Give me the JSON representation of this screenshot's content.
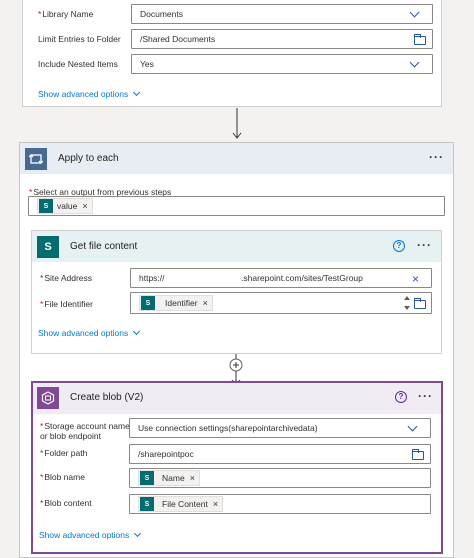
{
  "top_card": {
    "library_name": {
      "label": "Library Name",
      "required": true,
      "value": "Documents"
    },
    "limit_folder": {
      "label": "Limit Entries to Folder",
      "required": false,
      "value": "/Shared Documents"
    },
    "nested": {
      "label": "Include Nested Items",
      "required": false,
      "value": "Yes"
    },
    "advanced": "Show advanced options"
  },
  "apply_each": {
    "title": "Apply to each",
    "select_label": "Select an output from previous steps",
    "token": "value",
    "menu": "···"
  },
  "get_file": {
    "title": "Get file content",
    "site_label": "Site Address",
    "site_value_prefix": "https://",
    "site_value_suffix": ".sharepoint.com/sites/TestGroup",
    "file_label": "File Identifier",
    "file_token": "Identifier",
    "advanced": "Show advanced options",
    "help": "?",
    "menu": "···"
  },
  "create_blob": {
    "title": "Create blob (V2)",
    "storage_label_1": "Storage account name",
    "storage_label_2": "or blob endpoint",
    "storage_value": "Use connection settings(sharepointarchivedata)",
    "folder_label": "Folder path",
    "folder_value": "/sharepointpoc",
    "name_label": "Blob name",
    "name_token": "Name",
    "content_label": "Blob content",
    "content_token": "File Content",
    "advanced": "Show advanced options",
    "help": "?",
    "menu": "···"
  },
  "common": {
    "required_mark": "*",
    "remove_mark": "×",
    "sp_mark": "S"
  },
  "colors": {
    "apply_each_header": "#e8edf3",
    "apply_each_icon": "#486991",
    "get_file_header": "#e6f2f1",
    "sharepoint": "#036c70",
    "create_blob_border": "#804998",
    "create_blob_header": "#f1ebf4",
    "blob_icon": "#804998",
    "link": "#0078d4"
  }
}
